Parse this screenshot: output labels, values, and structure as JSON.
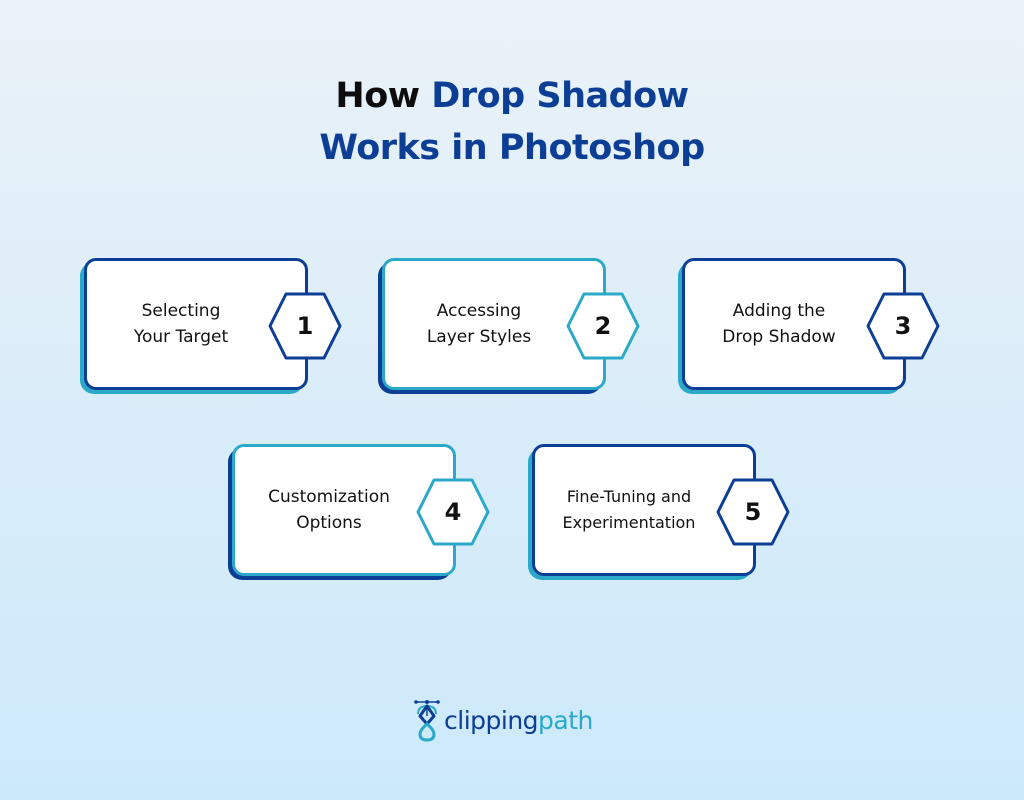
{
  "title": {
    "line1_plain": "How ",
    "line1_accent": "Drop Shadow",
    "line2_accent": "Works in Photoshop"
  },
  "colors": {
    "dark_blue": "#0c3e96",
    "teal": "#2aa9c9",
    "background_top": "#ebf2f7",
    "background_bottom": "#cce9fb"
  },
  "steps": [
    {
      "number": "1",
      "line1": "Selecting",
      "line2": "Your Target",
      "style": "blue"
    },
    {
      "number": "2",
      "line1": "Accessing",
      "line2": "Layer Styles",
      "style": "teal"
    },
    {
      "number": "3",
      "line1": "Adding the",
      "line2": "Drop Shadow",
      "style": "blue"
    },
    {
      "number": "4",
      "line1": "Customization",
      "line2": "Options",
      "style": "teal"
    },
    {
      "number": "5",
      "line1": "Fine-Tuning and",
      "line2": "Experimentation",
      "style": "blue"
    }
  ],
  "logo": {
    "icon": "pen-tool-icon",
    "text_primary": "clipping",
    "text_secondary": "path"
  }
}
